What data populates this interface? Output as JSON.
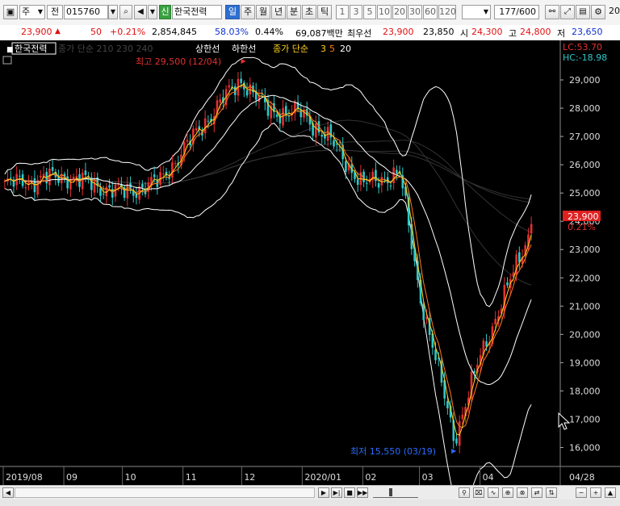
{
  "toolbar": {
    "market": "주",
    "type_label": "전",
    "code": "015760",
    "new_badge": "신",
    "stock_name": "한국전력",
    "periods": [
      "일",
      "주",
      "월",
      "년",
      "분",
      "초",
      "틱"
    ],
    "active_period": "일",
    "intervals": [
      "1",
      "3",
      "5",
      "10",
      "20",
      "30",
      "60",
      "120"
    ],
    "counter": "177",
    "counter_total": "/600",
    "right_cut": "20"
  },
  "info": {
    "price": "23,900",
    "arrow": "▲",
    "change": "50",
    "change_pct": "+0.21%",
    "volume": "2,854,845",
    "volume_ratio": "58.03%",
    "turnover": "0.44%",
    "amount": "69,087백만",
    "best_label": "최우선",
    "best_ask": "23,900",
    "best_bid": "23,850",
    "open_label": "시",
    "open": "24,300",
    "high_label": "고",
    "high": "24,800",
    "low_label": "저",
    "low": "23,650"
  },
  "legend": {
    "name": "한국전력",
    "ma_faded": "종가 단순 210  230  240",
    "upper": "상한선",
    "lower": "하한선",
    "ma_label": "종가 단순",
    "ma3": "3",
    "ma5": "5",
    "ma20": "20"
  },
  "annotations": {
    "high": "최고 29,500 (12/04)",
    "low": "최저 15,550 (03/19)"
  },
  "right_axis": {
    "lc": "LC:53.70",
    "hc": "HC:-18.98",
    "ticks": [
      "29,000",
      "28,000",
      "27,000",
      "26,000",
      "25,000",
      "24,000",
      "23,000",
      "22,000",
      "21,000",
      "20,000",
      "19,000",
      "18,000",
      "17,000",
      "16,000"
    ],
    "current": "23,900",
    "current_pct": "0.21%"
  },
  "x_axis": {
    "labels": [
      "2019/08",
      "09",
      "10",
      "11",
      "12",
      "2020/01",
      "02",
      "03",
      "04"
    ],
    "right_label": "04/28"
  },
  "chart_data": {
    "type": "candlestick",
    "title": "한국전력",
    "x_start": "2019-08",
    "x_end": "2020-04-28",
    "ylim": [
      15500,
      29600
    ],
    "y_ticks": [
      16000,
      17000,
      18000,
      19000,
      20000,
      21000,
      22000,
      23000,
      24000,
      25000,
      26000,
      27000,
      28000,
      29000
    ],
    "overlays": [
      "종가 단순 3",
      "종가 단순 5",
      "종가 단순 20",
      "상한선",
      "하한선"
    ],
    "high": {
      "value": 29500,
      "date": "12/04"
    },
    "low": {
      "value": 15550,
      "date": "03/19"
    },
    "last": 23900,
    "last_change_pct": 0.21,
    "close_path": [
      {
        "date": "2019-08",
        "close": 25300
      },
      {
        "date": "2019-09",
        "close": 25600
      },
      {
        "date": "2019-10",
        "close": 25000
      },
      {
        "date": "2019-10-20",
        "close": 25400
      },
      {
        "date": "2019-11",
        "close": 26500
      },
      {
        "date": "2019-11-20",
        "close": 28200
      },
      {
        "date": "2019-12",
        "close": 29000
      },
      {
        "date": "2019-12-15",
        "close": 27900
      },
      {
        "date": "2020-01",
        "close": 27800
      },
      {
        "date": "2020-01-15",
        "close": 26900
      },
      {
        "date": "2020-02",
        "close": 25300
      },
      {
        "date": "2020-02-20",
        "close": 25700
      },
      {
        "date": "2020-03",
        "close": 21500
      },
      {
        "date": "2020-03-19",
        "close": 16300
      },
      {
        "date": "2020-04",
        "close": 19200
      },
      {
        "date": "2020-04-28",
        "close": 23900
      }
    ]
  },
  "colors": {
    "up": "#e53030",
    "down": "#30c8c8",
    "band": "#ffffff",
    "ma": "#ffd21e"
  }
}
